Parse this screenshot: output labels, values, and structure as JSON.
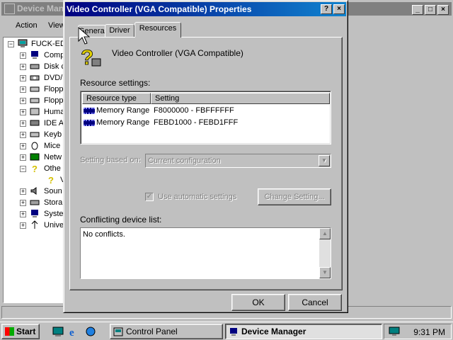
{
  "background_window": {
    "title": "Device Manager",
    "menu": [
      "Action",
      "View"
    ],
    "tree": {
      "root": "FUCK-ED",
      "items": [
        "Comp",
        "Disk c",
        "DVD/",
        "Flopp",
        "Flopp",
        "Huma",
        "IDE A",
        "Keyb",
        "Mice",
        "Netw",
        "Othe",
        "V",
        "Soun",
        "Stora",
        "Syste",
        "Unive"
      ]
    }
  },
  "dialog": {
    "title": "Video Controller (VGA Compatible) Properties",
    "help_button": "?",
    "close_button": "×",
    "tabs": [
      "General",
      "Driver",
      "Resources"
    ],
    "device_name": "Video Controller (VGA Compatible)",
    "resource_settings_label": "Resource settings:",
    "columns": [
      "Resource type",
      "Setting"
    ],
    "resources": [
      {
        "type": "Memory Range",
        "setting": "F8000000 - FBFFFFFF"
      },
      {
        "type": "Memory Range",
        "setting": "FEBD1000 - FEBD1FFF"
      }
    ],
    "setting_based_on_label": "Setting based on:",
    "setting_based_on_value": "Current configuration",
    "use_automatic_label": "Use automatic settings",
    "use_automatic_checked": true,
    "change_setting_button": "Change Setting...",
    "conflicting_label": "Conflicting device list:",
    "conflicts_text": "No conflicts.",
    "ok_button": "OK",
    "cancel_button": "Cancel"
  },
  "taskbar": {
    "start": "Start",
    "tasks": [
      "Control Panel",
      "Device Manager"
    ],
    "clock": "9:31 PM"
  },
  "colors": {
    "desktop": "#008080",
    "face": "#c0c0c0",
    "title_active": "#000080",
    "title_inactive": "#808080"
  }
}
